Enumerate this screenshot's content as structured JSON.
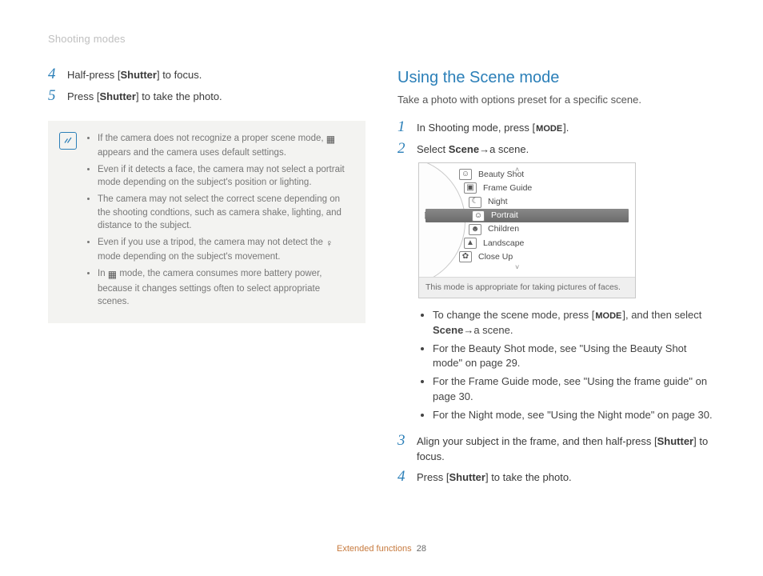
{
  "header": {
    "section": "Shooting modes"
  },
  "left": {
    "steps": [
      {
        "n": "4",
        "pre": "Half-press [",
        "bold": "Shutter",
        "post": "] to focus."
      },
      {
        "n": "5",
        "pre": "Press [",
        "bold": "Shutter",
        "post": "] to take the photo."
      }
    ],
    "notes": [
      {
        "pre": "If the camera does not recognize a proper scene mode, ",
        "icon": true,
        "post": " appears and the camera uses default settings."
      },
      {
        "text": "Even if it detects a face, the camera may not select a portrait mode depending on the subject's position or lighting."
      },
      {
        "text": "The camera may not select the correct scene depending on the shooting condtions, such as camera shake, lighting, and distance to the subject."
      },
      {
        "pre": "Even if you use a tripod, the camera may not detect the ",
        "icon2": true,
        "post": " mode depending on the subject's movement."
      },
      {
        "pre": "In ",
        "icon3": true,
        "post": " mode, the camera consumes more battery power, because it changes settings often to select appropriate scenes."
      }
    ]
  },
  "right": {
    "title": "Using the Scene mode",
    "lead": "Take a photo with options preset for a specific scene.",
    "steps12": [
      {
        "n": "1",
        "pre": "In Shooting mode, press [",
        "mode": "MODE",
        "post": "]."
      },
      {
        "n": "2",
        "pre": "Select ",
        "bold": "Scene",
        "arrow": " → ",
        "post": "a scene."
      }
    ],
    "scene": {
      "items": [
        {
          "icon": "beauty-shot-icon",
          "glyph": "☺",
          "label": "Beauty Shot",
          "sel": false
        },
        {
          "icon": "frame-guide-icon",
          "glyph": "▣",
          "label": "Frame Guide",
          "sel": false
        },
        {
          "icon": "night-icon",
          "glyph": "☾",
          "label": "Night",
          "sel": false
        },
        {
          "icon": "portrait-icon",
          "glyph": "☺",
          "label": "Portrait",
          "sel": true
        },
        {
          "icon": "children-icon",
          "glyph": "☻",
          "label": "Children",
          "sel": false
        },
        {
          "icon": "landscape-icon",
          "glyph": "▲",
          "label": "Landscape",
          "sel": false
        },
        {
          "icon": "closeup-icon",
          "glyph": "✿",
          "label": "Close Up",
          "sel": false
        }
      ],
      "hint": "This mode is appropriate for taking pictures of faces."
    },
    "bullets": [
      {
        "pre": "To change the scene mode, press [",
        "mode": "MODE",
        "mid": "], and then select ",
        "bold": "Scene",
        "arrow": " → ",
        "post": "a scene."
      },
      {
        "text": "For the Beauty Shot mode, see \"Using the Beauty Shot mode\" on page 29."
      },
      {
        "text": "For the Frame Guide mode, see \"Using the frame guide\" on page 30."
      },
      {
        "text": "For the Night mode, see \"Using the Night mode\" on page 30."
      }
    ],
    "steps34": [
      {
        "n": "3",
        "pre": "Align your subject in the frame, and then half-press [",
        "bold": "Shutter",
        "post": "] to focus."
      },
      {
        "n": "4",
        "pre": "Press [",
        "bold": "Shutter",
        "post": "] to take the photo."
      }
    ]
  },
  "footer": {
    "label": "Extended functions",
    "page": "28"
  }
}
